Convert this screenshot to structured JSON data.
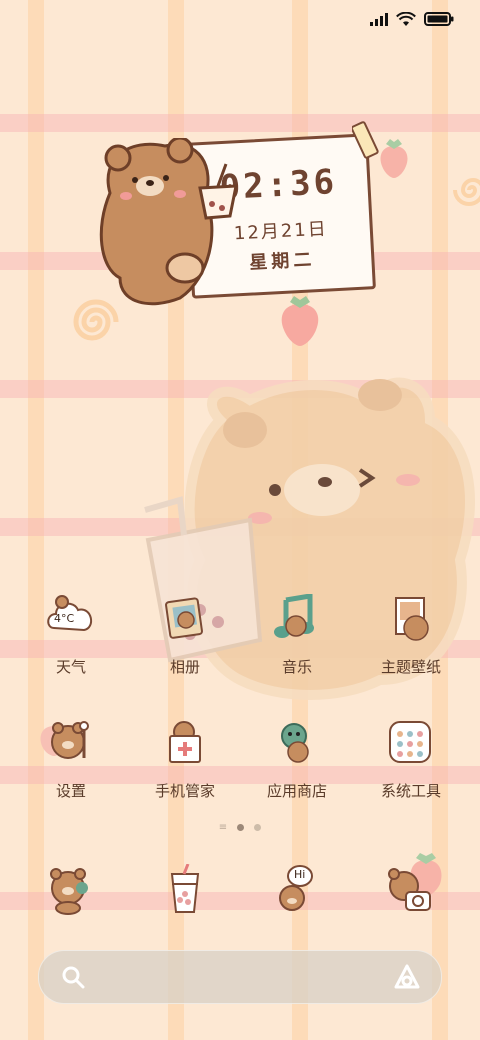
{
  "status_bar": {
    "signal_icon": "signal-icon",
    "wifi_icon": "wifi-icon",
    "battery_icon": "battery-icon"
  },
  "clock_widget": {
    "time": "02:36",
    "date": "12月21日",
    "weekday": "星期二"
  },
  "apps": [
    {
      "label": "天气",
      "icon": "weather-icon",
      "temp": "4°C"
    },
    {
      "label": "相册",
      "icon": "gallery-icon"
    },
    {
      "label": "音乐",
      "icon": "music-icon"
    },
    {
      "label": "主题壁纸",
      "icon": "theme-wallpaper-icon"
    },
    {
      "label": "设置",
      "icon": "settings-icon"
    },
    {
      "label": "手机管家",
      "icon": "phone-manager-icon"
    },
    {
      "label": "应用商店",
      "icon": "app-store-icon"
    },
    {
      "label": "系统工具",
      "icon": "system-tools-icon"
    }
  ],
  "dock": [
    {
      "icon": "phone-icon"
    },
    {
      "icon": "messages-icon"
    },
    {
      "icon": "browser-icon",
      "bubble": "Hi"
    },
    {
      "icon": "camera-icon"
    }
  ],
  "pager": {
    "pages": 3,
    "active": 1
  },
  "search_bar": {
    "search_icon": "search-icon",
    "assistant_icon": "assistant-icon"
  },
  "colors": {
    "background": "#fde8d3",
    "text": "#5a3b2a",
    "clock": "#6f4330"
  }
}
